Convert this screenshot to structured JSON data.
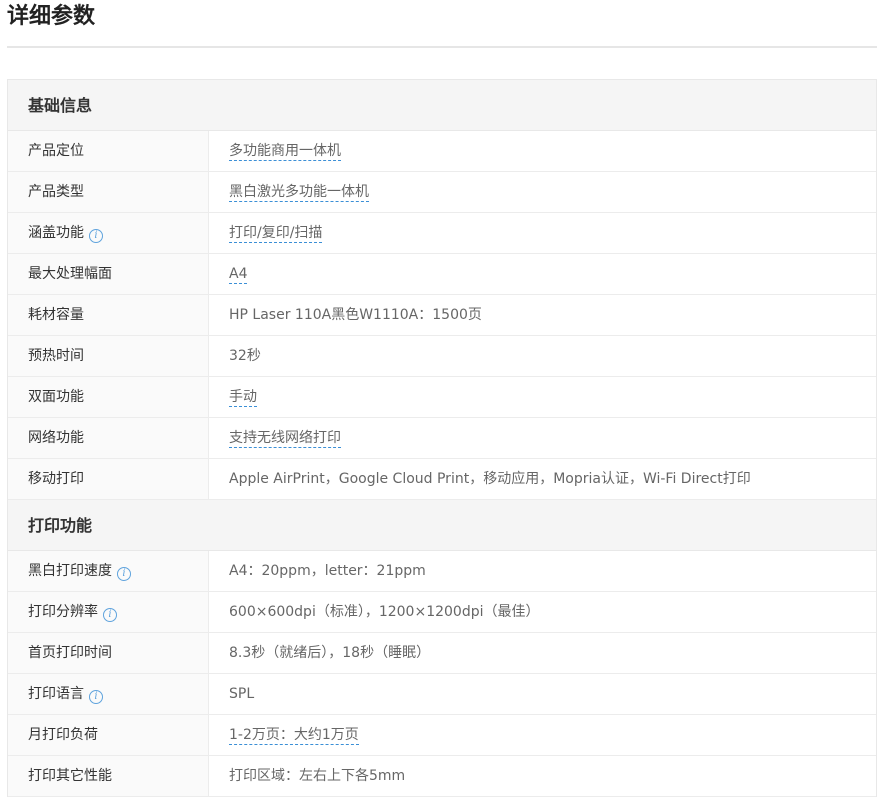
{
  "page": {
    "title": "详细参数"
  },
  "sections": [
    {
      "title": "基础信息",
      "rows": [
        {
          "label": "产品定位",
          "value": "多功能商用一体机"
        },
        {
          "label": "产品类型",
          "value": "黑白激光多功能一体机"
        },
        {
          "label": "涵盖功能",
          "value": "打印/复印/扫描"
        },
        {
          "label": "最大处理幅面",
          "value": "A4"
        },
        {
          "label": "耗材容量",
          "value": "HP Laser 110A黑色W1110A：1500页"
        },
        {
          "label": "预热时间",
          "value": "32秒"
        },
        {
          "label": "双面功能",
          "value": "手动"
        },
        {
          "label": "网络功能",
          "value": "支持无线网络打印"
        },
        {
          "label": "移动打印",
          "value": "Apple AirPrint，Google Cloud Print，移动应用，Mopria认证，Wi-Fi Direct打印"
        }
      ]
    },
    {
      "title": "打印功能",
      "rows": [
        {
          "label": "黑白打印速度",
          "value": "A4：20ppm，letter：21ppm"
        },
        {
          "label": "打印分辨率",
          "value": "600×600dpi（标准），1200×1200dpi（最佳）"
        },
        {
          "label": "首页打印时间",
          "value": "8.3秒（就绪后），18秒（睡眠）"
        },
        {
          "label": "打印语言",
          "value": "SPL"
        },
        {
          "label": "月打印负荷",
          "value": "1-2万页：大约1万页"
        },
        {
          "label": "打印其它性能",
          "value": "打印区域：左右上下各5mm"
        }
      ]
    }
  ],
  "icons": {
    "info": "info-icon"
  },
  "colors": {
    "link_underline": "#3b8fd6",
    "info_icon": "#5fa3dd",
    "header_bg": "#f5f5f5"
  }
}
